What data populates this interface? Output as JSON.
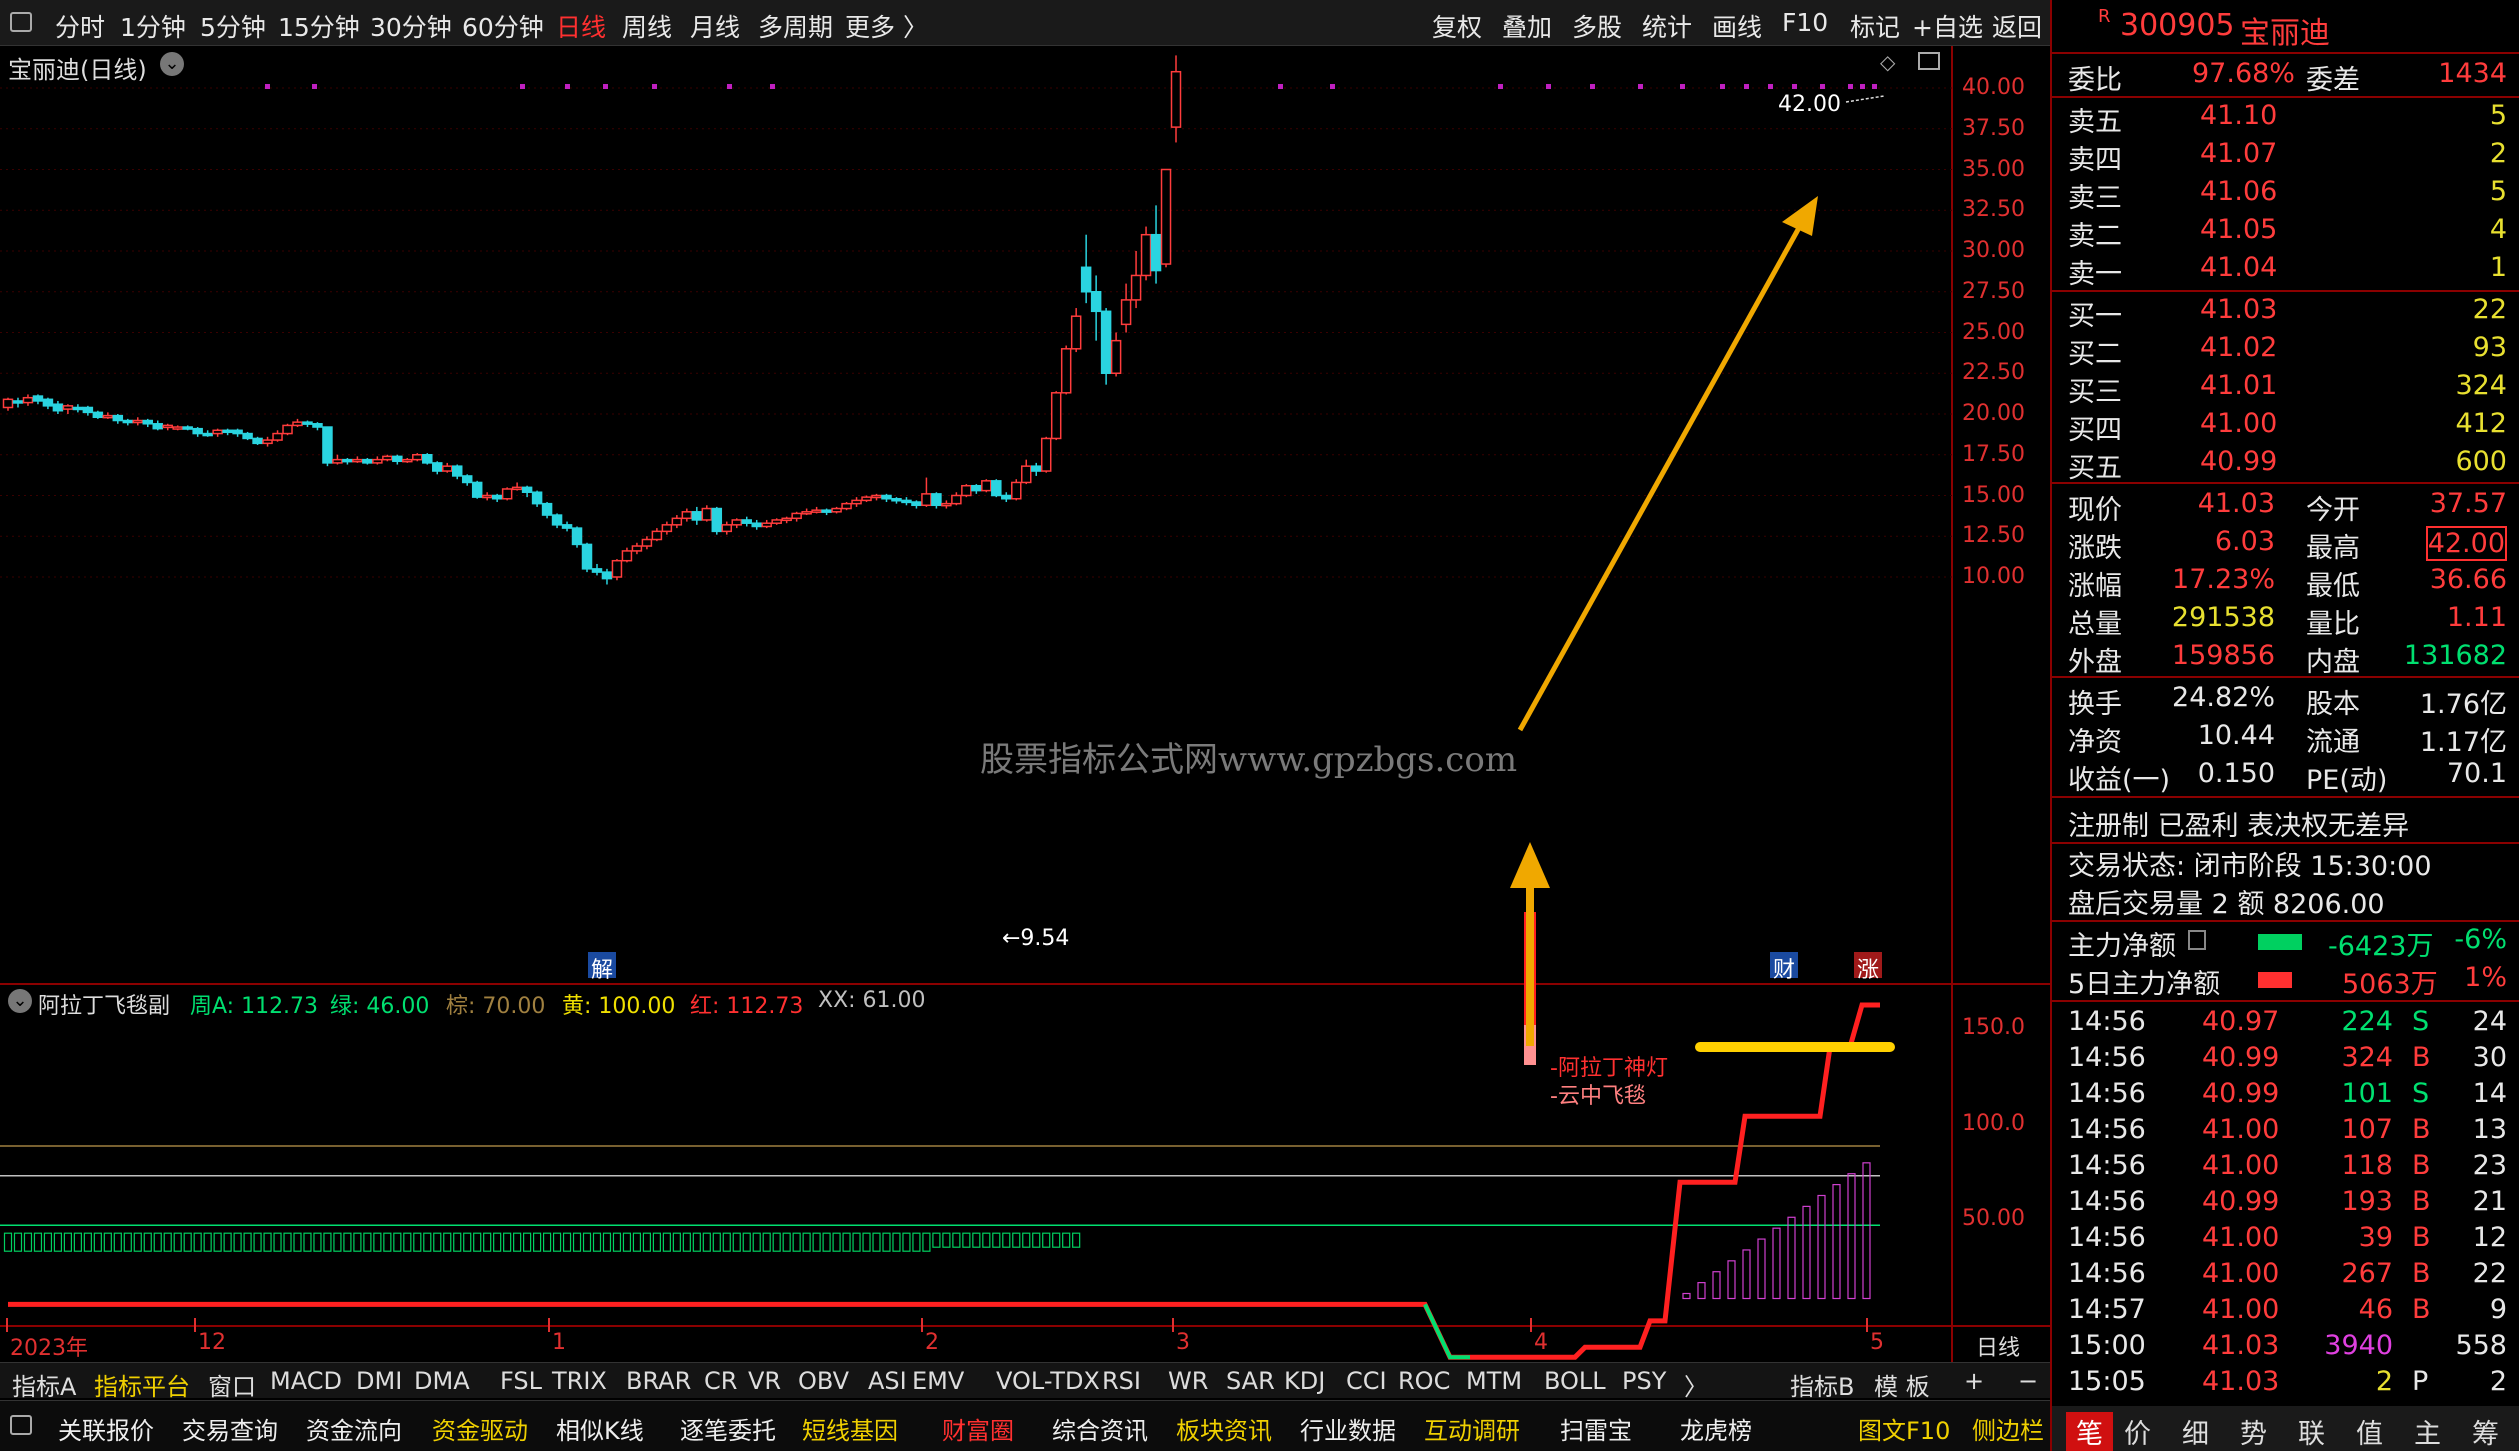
{
  "toolbar": {
    "periods": [
      "分时",
      "1分钟",
      "5分钟",
      "15分钟",
      "30分钟",
      "60分钟",
      "日线",
      "周线",
      "月线",
      "多周期",
      "更多 〉"
    ],
    "active_period": "日线",
    "right_buttons": [
      "复权",
      "叠加",
      "多股",
      "统计",
      "画线",
      "F10",
      "标记",
      "+自选",
      "返回"
    ]
  },
  "chart": {
    "title": "宝丽迪(日线)",
    "watermark": "股票指标公式网www.gpzbgs.com",
    "high_label": "42.00",
    "low_label": "←9.54",
    "y_labels": [
      "40.00",
      "37.50",
      "35.00",
      "32.50",
      "30.00",
      "27.50",
      "25.00",
      "22.50",
      "20.00",
      "17.50",
      "15.00",
      "12.50",
      "10.00"
    ],
    "markers": {
      "jie": "解",
      "cai": "财",
      "zhang": "涨"
    },
    "colors": {
      "up": "#ff3c3c",
      "down": "#2ad4e0",
      "arrow": "#f0a800"
    }
  },
  "indicator": {
    "name": "阿拉丁飞毯副",
    "legend": [
      {
        "text": "周A: 112.73",
        "color": "#00e070"
      },
      {
        "text": "绿: 46.00",
        "color": "#00e070"
      },
      {
        "text": "棕: 70.00",
        "color": "#a08040"
      },
      {
        "text": "黄: 100.00",
        "color": "#f0e000"
      },
      {
        "text": "红: 112.73",
        "color": "#ff3030"
      },
      {
        "text": "XX: 61.00",
        "color": "#c0c0c0"
      }
    ],
    "y_labels": [
      "150.0",
      "100.0",
      "50.00"
    ],
    "signal_labels": [
      "-阿拉丁神灯",
      "-云中飞毯"
    ]
  },
  "x_axis": [
    "2023年",
    "12",
    "1",
    "2",
    "3",
    "4",
    "5",
    "日线"
  ],
  "indicator_tabs": [
    "指标A",
    "指标平台",
    "窗口",
    "MACD",
    "DMI",
    "DMA",
    "FSL",
    "TRIX",
    "BRAR",
    "CR",
    "VR",
    "OBV",
    "ASI",
    "EMV",
    "VOL-TDX",
    "RSI",
    "WR",
    "SAR",
    "KDJ",
    "CCI",
    "ROC",
    "MTM",
    "BOLL",
    "PSY",
    "〉",
    "指标B",
    "模 板",
    "+",
    "−"
  ],
  "function_bar": [
    "关联报价",
    "交易查询",
    "资金流向",
    "资金驱动",
    "相似K线",
    "逐笔委托",
    "短线基因",
    "财富圈",
    "综合资讯",
    "板块资讯",
    "行业数据",
    "互动调研",
    "扫雷宝",
    "龙虎榜",
    "图文F10",
    "侧边栏"
  ],
  "quote": {
    "code": "300905",
    "name": "宝丽迪",
    "weibi": {
      "label": "委比",
      "value": "97.68%",
      "diff_label": "委差",
      "diff": "1434"
    },
    "asks": [
      {
        "label": "卖五",
        "price": "41.10",
        "vol": "5"
      },
      {
        "label": "卖四",
        "price": "41.07",
        "vol": "2"
      },
      {
        "label": "卖三",
        "price": "41.06",
        "vol": "5"
      },
      {
        "label": "卖二",
        "price": "41.05",
        "vol": "4"
      },
      {
        "label": "卖一",
        "price": "41.04",
        "vol": "1"
      }
    ],
    "bids": [
      {
        "label": "买一",
        "price": "41.03",
        "vol": "22"
      },
      {
        "label": "买二",
        "price": "41.02",
        "vol": "93"
      },
      {
        "label": "买三",
        "price": "41.01",
        "vol": "324"
      },
      {
        "label": "买四",
        "price": "41.00",
        "vol": "412"
      },
      {
        "label": "买五",
        "price": "40.99",
        "vol": "600"
      }
    ],
    "stats": [
      {
        "l1": "现价",
        "v1": "41.03",
        "c1": "red",
        "l2": "今开",
        "v2": "37.57",
        "c2": "red"
      },
      {
        "l1": "涨跌",
        "v1": "6.03",
        "c1": "red",
        "l2": "最高",
        "v2": "42.00",
        "c2": "red"
      },
      {
        "l1": "涨幅",
        "v1": "17.23%",
        "c1": "red",
        "l2": "最低",
        "v2": "36.66",
        "c2": "red"
      },
      {
        "l1": "总量",
        "v1": "291538",
        "c1": "yellow",
        "l2": "量比",
        "v2": "1.11",
        "c2": "red"
      },
      {
        "l1": "外盘",
        "v1": "159856",
        "c1": "red",
        "l2": "内盘",
        "v2": "131682",
        "c2": "green"
      }
    ],
    "stats2": [
      {
        "l1": "换手",
        "v1": "24.82%",
        "l2": "股本",
        "v2": "1.76亿"
      },
      {
        "l1": "净资",
        "v1": "10.44",
        "l2": "流通",
        "v2": "1.17亿"
      },
      {
        "l1": "收益(一)",
        "v1": "0.150",
        "l2": "PE(动)",
        "v2": "70.1"
      }
    ],
    "note": "注册制 已盈利 表决权无差异",
    "status": "交易状态: 闭市阶段 15:30:00",
    "after_hours": "盘后交易量 2 额 8206.00",
    "main_flow": {
      "label": "主力净额",
      "value": "-6423万",
      "pct": "-6%"
    },
    "main_flow5": {
      "label": "5日主力净额",
      "value": "5063万",
      "pct": "1%"
    },
    "ticks": [
      {
        "t": "14:56",
        "p": "40.97",
        "v": "224",
        "bs": "S",
        "n": "24"
      },
      {
        "t": "14:56",
        "p": "40.99",
        "v": "324",
        "bs": "B",
        "n": "30"
      },
      {
        "t": "14:56",
        "p": "40.99",
        "v": "101",
        "bs": "S",
        "n": "14"
      },
      {
        "t": "14:56",
        "p": "41.00",
        "v": "107",
        "bs": "B",
        "n": "13"
      },
      {
        "t": "14:56",
        "p": "41.00",
        "v": "118",
        "bs": "B",
        "n": "23"
      },
      {
        "t": "14:56",
        "p": "40.99",
        "v": "193",
        "bs": "B",
        "n": "21"
      },
      {
        "t": "14:56",
        "p": "41.00",
        "v": "39",
        "bs": "B",
        "n": "12"
      },
      {
        "t": "14:56",
        "p": "41.00",
        "v": "267",
        "bs": "B",
        "n": "22"
      },
      {
        "t": "14:57",
        "p": "41.00",
        "v": "46",
        "bs": "B",
        "n": "9"
      },
      {
        "t": "15:00",
        "p": "41.03",
        "v": "3940",
        "bs": "",
        "n": "558"
      },
      {
        "t": "15:05",
        "p": "41.03",
        "v": "2",
        "bs": "P",
        "n": "2"
      }
    ],
    "tabs": [
      "笔",
      "价",
      "细",
      "势",
      "联",
      "值",
      "主",
      "筹"
    ]
  },
  "candles": [
    [
      10.1,
      20.4,
      20.9,
      20.2,
      21.0
    ],
    [
      10.0,
      20.8,
      20.7,
      20.4,
      21.0
    ],
    [
      10.0,
      20.7,
      21.0,
      20.5,
      21.2
    ],
    [
      10.0,
      21.1,
      20.8,
      20.6,
      21.2
    ],
    [
      10.0,
      20.9,
      20.5,
      20.3,
      21.0
    ],
    [
      10.0,
      20.6,
      20.2,
      20.0,
      20.8
    ],
    [
      10.0,
      20.3,
      20.5,
      20.0,
      20.6
    ],
    [
      10.0,
      20.4,
      20.3,
      20.1,
      20.6
    ],
    [
      10.0,
      20.4,
      20.1,
      19.9,
      20.5
    ],
    [
      10.0,
      20.1,
      19.8,
      19.7,
      20.2
    ],
    [
      10.0,
      19.9,
      19.9,
      19.7,
      20.1
    ],
    [
      10.0,
      19.9,
      19.6,
      19.4,
      20.0
    ],
    [
      10.0,
      19.6,
      19.5,
      19.3,
      19.7
    ],
    [
      10.0,
      19.5,
      19.6,
      19.3,
      19.8
    ],
    [
      10.0,
      19.6,
      19.4,
      19.2,
      19.7
    ],
    [
      10.0,
      19.4,
      19.1,
      19.0,
      19.6
    ],
    [
      10.0,
      19.2,
      19.3,
      19.0,
      19.4
    ],
    [
      10.0,
      19.2,
      19.2,
      19.0,
      19.3
    ],
    [
      10.0,
      19.2,
      19.1,
      19.0,
      19.3
    ],
    [
      10.0,
      19.1,
      18.8,
      18.6,
      19.2
    ],
    [
      10.0,
      18.8,
      18.7,
      18.6,
      19.0
    ],
    [
      10.0,
      18.8,
      19.0,
      18.6,
      19.1
    ],
    [
      10.0,
      19.0,
      18.9,
      18.7,
      19.1
    ],
    [
      10.0,
      19.0,
      18.8,
      18.6,
      19.1
    ],
    [
      10.0,
      18.8,
      18.5,
      18.4,
      18.9
    ],
    [
      10.0,
      18.5,
      18.2,
      18.1,
      18.6
    ],
    [
      10.0,
      18.2,
      18.4,
      18.0,
      18.6
    ],
    [
      10.0,
      18.4,
      18.8,
      18.3,
      19.0
    ],
    [
      10.0,
      18.8,
      19.3,
      18.7,
      19.4
    ],
    [
      10.0,
      19.3,
      19.5,
      19.2,
      19.7
    ],
    [
      10.0,
      19.5,
      19.4,
      19.2,
      19.6
    ],
    [
      10.0,
      19.4,
      19.2,
      19.0,
      19.5
    ],
    [
      10.0,
      19.2,
      17.0,
      16.8,
      19.2
    ],
    [
      10.0,
      17.0,
      17.2,
      16.9,
      17.5
    ],
    [
      10.0,
      17.2,
      17.1,
      16.9,
      17.3
    ],
    [
      10.0,
      17.1,
      17.2,
      17.0,
      17.4
    ],
    [
      10.0,
      17.2,
      17.0,
      16.9,
      17.3
    ],
    [
      10.0,
      17.0,
      17.2,
      16.9,
      17.4
    ],
    [
      10.0,
      17.2,
      17.4,
      17.1,
      17.5
    ],
    [
      10.0,
      17.4,
      17.1,
      16.9,
      17.5
    ],
    [
      10.0,
      17.1,
      17.2,
      17.0,
      17.3
    ],
    [
      10.0,
      17.2,
      17.5,
      17.1,
      17.6
    ],
    [
      10.0,
      17.5,
      17.0,
      16.9,
      17.6
    ],
    [
      10.0,
      17.0,
      16.5,
      16.3,
      17.1
    ],
    [
      10.0,
      16.5,
      16.8,
      16.4,
      17.0
    ],
    [
      10.0,
      16.8,
      16.2,
      16.0,
      16.9
    ],
    [
      10.0,
      16.2,
      15.8,
      15.6,
      16.3
    ],
    [
      10.0,
      15.8,
      14.9,
      14.8,
      15.9
    ],
    [
      10.0,
      14.9,
      15.0,
      14.7,
      15.2
    ],
    [
      10.0,
      15.0,
      14.8,
      14.6,
      15.1
    ],
    [
      10.0,
      14.8,
      15.4,
      14.7,
      15.5
    ],
    [
      10.0,
      15.4,
      15.5,
      15.3,
      15.8
    ],
    [
      10.0,
      15.5,
      15.2,
      14.9,
      15.6
    ],
    [
      10.0,
      15.2,
      14.5,
      14.3,
      15.3
    ],
    [
      10.0,
      14.5,
      13.8,
      13.6,
      14.6
    ],
    [
      10.0,
      13.8,
      13.2,
      13.0,
      13.9
    ],
    [
      10.0,
      13.2,
      13.0,
      12.8,
      13.4
    ],
    [
      10.0,
      13.0,
      12.0,
      11.8,
      13.1
    ],
    [
      10.0,
      12.0,
      10.5,
      10.3,
      12.1
    ],
    [
      10.0,
      10.5,
      10.3,
      10.1,
      10.8
    ],
    [
      10.0,
      10.3,
      9.9,
      9.54,
      10.5
    ],
    [
      10.0,
      10.0,
      11.0,
      9.8,
      11.1
    ],
    [
      10.0,
      11.0,
      11.6,
      10.9,
      11.8
    ],
    [
      10.0,
      11.6,
      11.9,
      11.4,
      12.1
    ],
    [
      10.0,
      11.9,
      12.3,
      11.7,
      12.5
    ],
    [
      10.0,
      12.3,
      12.8,
      12.2,
      13.0
    ],
    [
      10.0,
      12.8,
      13.2,
      12.6,
      13.4
    ],
    [
      10.0,
      13.2,
      13.6,
      13.0,
      13.8
    ],
    [
      10.0,
      13.6,
      14.0,
      13.4,
      14.2
    ],
    [
      10.0,
      14.0,
      13.5,
      13.2,
      14.3
    ],
    [
      10.0,
      13.5,
      14.2,
      13.4,
      14.4
    ],
    [
      10.0,
      14.2,
      12.8,
      12.6,
      14.3
    ],
    [
      10.0,
      12.8,
      13.2,
      12.6,
      13.4
    ],
    [
      10.0,
      13.2,
      13.5,
      13.0,
      13.6
    ],
    [
      10.0,
      13.5,
      13.3,
      13.1,
      13.7
    ],
    [
      10.0,
      13.3,
      13.1,
      12.9,
      13.5
    ],
    [
      10.0,
      13.1,
      13.3,
      13.0,
      13.5
    ],
    [
      10.0,
      13.3,
      13.5,
      13.2,
      13.6
    ],
    [
      10.0,
      13.5,
      13.6,
      13.3,
      13.7
    ],
    [
      10.0,
      13.6,
      13.9,
      13.4,
      14.0
    ],
    [
      10.0,
      13.9,
      14.0,
      13.8,
      14.2
    ],
    [
      10.0,
      14.0,
      14.1,
      13.9,
      14.3
    ],
    [
      10.0,
      14.1,
      14.0,
      13.8,
      14.2
    ],
    [
      10.0,
      14.0,
      14.2,
      13.9,
      14.3
    ],
    [
      10.0,
      14.2,
      14.5,
      14.1,
      14.6
    ],
    [
      10.0,
      14.5,
      14.7,
      14.3,
      14.9
    ],
    [
      10.0,
      14.7,
      14.9,
      14.6,
      15.0
    ],
    [
      10.0,
      14.9,
      15.0,
      14.7,
      15.1
    ],
    [
      10.0,
      15.0,
      14.8,
      14.6,
      15.1
    ],
    [
      10.0,
      14.8,
      14.7,
      14.5,
      14.9
    ],
    [
      10.0,
      14.7,
      14.6,
      14.4,
      14.9
    ],
    [
      10.0,
      14.6,
      14.4,
      14.2,
      14.7
    ],
    [
      10.0,
      14.4,
      15.1,
      14.3,
      16.1
    ],
    [
      10.0,
      15.1,
      14.4,
      14.2,
      15.2
    ],
    [
      10.0,
      14.4,
      14.5,
      14.2,
      14.7
    ],
    [
      10.0,
      14.5,
      15.0,
      14.4,
      15.2
    ],
    [
      10.0,
      15.0,
      15.6,
      14.9,
      15.7
    ],
    [
      10.0,
      15.6,
      15.3,
      15.1,
      15.7
    ],
    [
      10.0,
      15.3,
      15.9,
      15.2,
      16.0
    ],
    [
      10.0,
      15.9,
      15.0,
      14.9,
      16.0
    ],
    [
      10.0,
      15.0,
      14.8,
      14.6,
      15.2
    ],
    [
      10.0,
      14.8,
      15.8,
      14.7,
      16.0
    ],
    [
      10.0,
      15.8,
      16.8,
      15.7,
      17.2
    ],
    [
      10.0,
      16.8,
      16.5,
      16.2,
      17.0
    ],
    [
      10.0,
      16.5,
      18.5,
      16.4,
      18.6
    ],
    [
      10.0,
      18.5,
      21.3,
      18.4,
      21.4
    ],
    [
      10.0,
      21.3,
      24.0,
      21.2,
      24.2
    ],
    [
      10.0,
      24.0,
      26.0,
      23.8,
      26.5
    ],
    [
      10.0,
      29.0,
      27.5,
      26.8,
      31.0
    ],
    [
      10.0,
      27.5,
      26.3,
      24.5,
      28.5
    ],
    [
      10.0,
      26.3,
      22.5,
      21.8,
      26.5
    ],
    [
      10.0,
      22.5,
      24.5,
      22.3,
      25.0
    ],
    [
      10.0,
      25.5,
      27.0,
      25.0,
      28.0
    ],
    [
      10.0,
      27.0,
      28.5,
      26.5,
      30.0
    ],
    [
      10.0,
      28.5,
      31.0,
      28.2,
      31.5
    ],
    [
      10.0,
      31.0,
      28.8,
      28.0,
      32.8
    ],
    [
      10.0,
      29.2,
      35.0,
      29.0,
      35.0
    ],
    [
      10.0,
      37.6,
      41.0,
      36.66,
      42.0
    ]
  ]
}
